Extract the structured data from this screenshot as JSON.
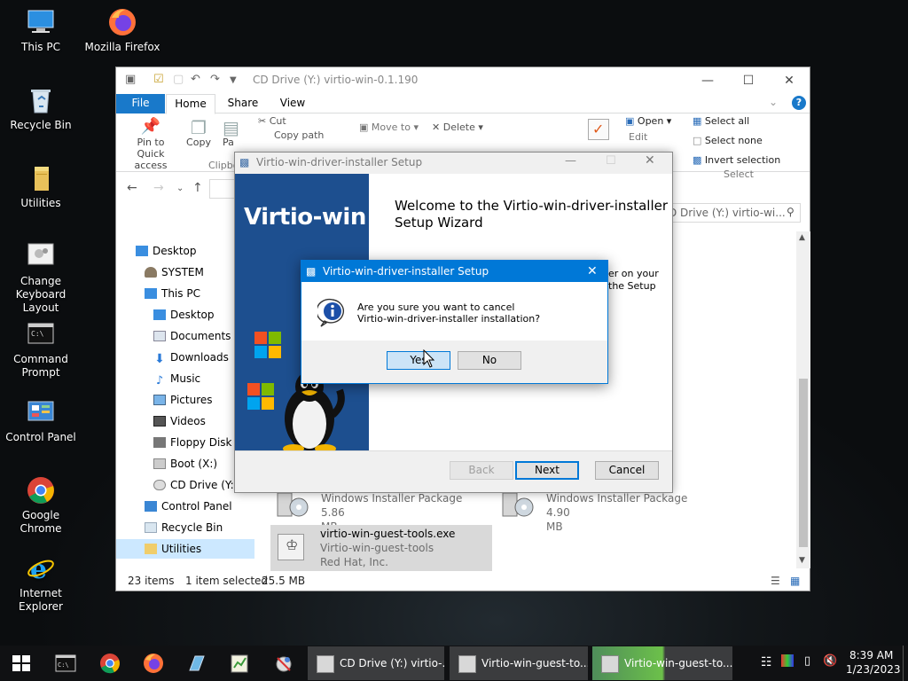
{
  "desktop": {
    "icons": [
      {
        "label": "This PC",
        "icon": "computer-icon"
      },
      {
        "label": "Mozilla Firefox",
        "icon": "firefox-icon"
      },
      {
        "label": "Recycle Bin",
        "icon": "recycle-bin-icon"
      },
      {
        "label": "Utilities",
        "icon": "folder-icon"
      },
      {
        "label": "Change Keyboard Layout",
        "icon": "keyboard-layout-icon"
      },
      {
        "label": "Command Prompt",
        "icon": "command-prompt-icon"
      },
      {
        "label": "Control Panel",
        "icon": "control-panel-icon"
      },
      {
        "label": "Google Chrome",
        "icon": "chrome-icon"
      },
      {
        "label": "Internet Explorer",
        "icon": "internet-explorer-icon"
      }
    ]
  },
  "explorer": {
    "title": "CD Drive (Y:) virtio-win-0.1.190",
    "tabs": {
      "file": "File",
      "home": "Home",
      "share": "Share",
      "view": "View"
    },
    "ribbon": {
      "pin": "Pin to Quick access",
      "copy": "Copy",
      "paste": "Pa",
      "cut": "Cut",
      "copy_path": "Copy path",
      "clipboard": "Clipbo",
      "move_to": "Move to",
      "delete": "Delete",
      "open": "Open",
      "edit": "Edit",
      "select_all": "Select all",
      "select_none": "Select none",
      "invert_selection": "Invert selection",
      "select_group": "Select"
    },
    "search_placeholder": "D Drive (Y:) virtio-wi...",
    "tree": {
      "desktop": "Desktop",
      "system": "SYSTEM",
      "this_pc": "This PC",
      "desktop2": "Desktop",
      "documents": "Documents",
      "downloads": "Downloads",
      "music": "Music",
      "pictures": "Pictures",
      "videos": "Videos",
      "floppy": "Floppy Disk D",
      "boot": "Boot (X:)",
      "cd_drive": "CD Drive (Y:) v",
      "control_panel": "Control Panel",
      "recycle_bin": "Recycle Bin",
      "utilities": "Utilities"
    },
    "files": {
      "f1_type": "Windows Installer Package",
      "f1_size": "5.86 MB",
      "f2_type": "Windows Installer Package",
      "f2_size": "4.90 MB",
      "f3_name": "virtio-win-guest-tools.exe",
      "f3_desc": "Virtio-win-guest-tools",
      "f3_company": "Red Hat, Inc."
    },
    "status": {
      "items": "23 items",
      "selected": "1 item selected",
      "size": "25.5 MB"
    }
  },
  "setup": {
    "title": "Virtio-win-driver-installer Setup",
    "brand": "Virtio-win",
    "welcome": "Welcome to the Virtio-win-driver-installer Setup Wizard",
    "body_line1": "er on your",
    "body_line2": "the Setup",
    "back": "Back",
    "next": "Next",
    "cancel": "Cancel"
  },
  "dialog": {
    "title": "Virtio-win-driver-installer Setup",
    "message_line1": "Are you sure you want to cancel",
    "message_line2": "Virtio-win-driver-installer installation?",
    "yes": "Yes",
    "no": "No"
  },
  "taskbar": {
    "tasks": [
      {
        "label": "CD Drive (Y:) virtio-..."
      },
      {
        "label": "Virtio-win-guest-to..."
      },
      {
        "label": "Virtio-win-guest-to..."
      }
    ],
    "time": "8:39 AM",
    "date": "1/23/2023"
  },
  "colors": {
    "accent": "#0078d7",
    "banner": "#1d4f8f"
  }
}
